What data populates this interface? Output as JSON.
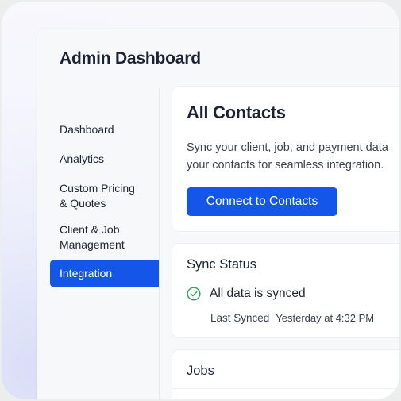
{
  "app": {
    "title": "Admin Dashboard"
  },
  "sidebar": {
    "items": [
      {
        "label": "Dashboard"
      },
      {
        "label": "Analytics"
      },
      {
        "label_line1": "Custom Pricing",
        "label_line2": "& Quotes"
      },
      {
        "label_line1": "Client & Job",
        "label_line2": "Management"
      },
      {
        "label": "Integration",
        "active": true
      }
    ]
  },
  "contacts_card": {
    "title": "All Contacts",
    "description_line1": "Sync your client, job, and payment data",
    "description_line2": "your contacts for seamless integration.",
    "button_label": "Connect to Contacts"
  },
  "sync_card": {
    "title": "Sync Status",
    "status_text": "All data is synced",
    "status_icon": "check-circle-icon",
    "last_synced_label": "Last Synced",
    "last_synced_value": "Yesterday at 4:32 PM"
  },
  "jobs_card": {
    "title": "Jobs"
  },
  "colors": {
    "accent": "#1356e8",
    "success": "#2f9e58",
    "text": "#1b2233"
  }
}
